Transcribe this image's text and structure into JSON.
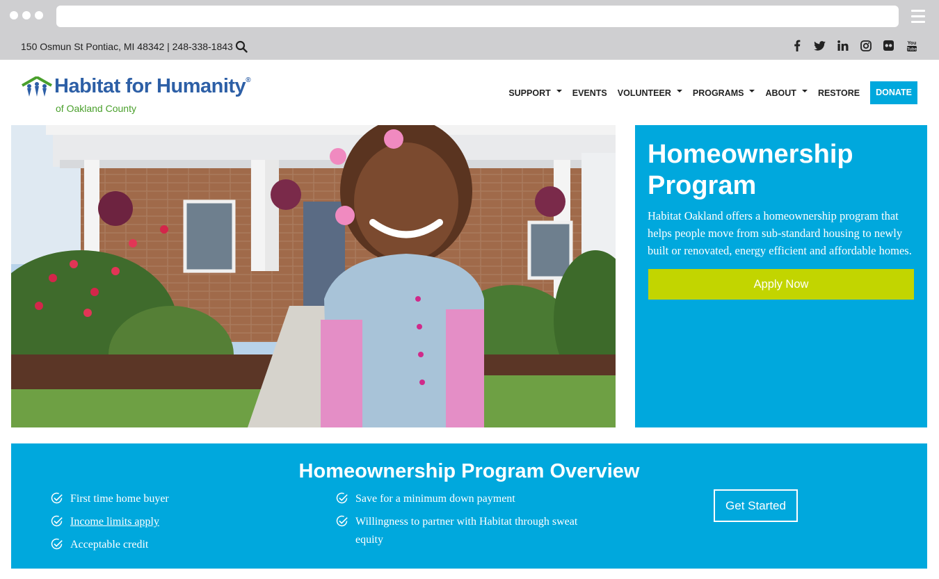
{
  "utility": {
    "address": "150 Osmun St Pontiac, MI 48342 | 248-338-1843",
    "social_icons": [
      "facebook-icon",
      "twitter-icon",
      "linkedin-icon",
      "instagram-icon",
      "flickr-icon",
      "youtube-icon"
    ],
    "social_glyphs": [
      "f",
      "t",
      "in",
      "◎",
      "●●",
      "You"
    ]
  },
  "logo": {
    "name": "Habitat for Humanity",
    "registered": "®",
    "sub": "of Oakland County",
    "colors": {
      "primary": "#2d5fa6",
      "secondary": "#4aa02c"
    }
  },
  "nav": {
    "items": [
      {
        "label": "SUPPORT",
        "dropdown": true
      },
      {
        "label": "EVENTS",
        "dropdown": false
      },
      {
        "label": "VOLUNTEER",
        "dropdown": true
      },
      {
        "label": "PROGRAMS",
        "dropdown": true
      },
      {
        "label": "ABOUT",
        "dropdown": true
      },
      {
        "label": "RESTORE",
        "dropdown": false
      }
    ],
    "donate": "DONATE"
  },
  "hero_panel": {
    "title": "Homeownership Program",
    "body": "Habitat Oakland offers a homeownership program that helps people move from sub-standard housing to newly built or renovated, energy efficient and affordable homes.",
    "button": "Apply Now"
  },
  "overview": {
    "title": "Homeownership Program Overview",
    "col1": [
      {
        "text": "First time home buyer",
        "link": false
      },
      {
        "text": "Income limits apply",
        "link": true
      },
      {
        "text": "Acceptable credit",
        "link": false
      }
    ],
    "col2": [
      {
        "text": "Save for a minimum down payment",
        "link": false
      },
      {
        "text": "Willingness to partner with Habitat through sweat equity",
        "link": false
      }
    ],
    "button": "Get Started"
  },
  "colors": {
    "accent": "#00a8dd",
    "apply": "#c2d500",
    "chrome": "#cfcfd1"
  }
}
